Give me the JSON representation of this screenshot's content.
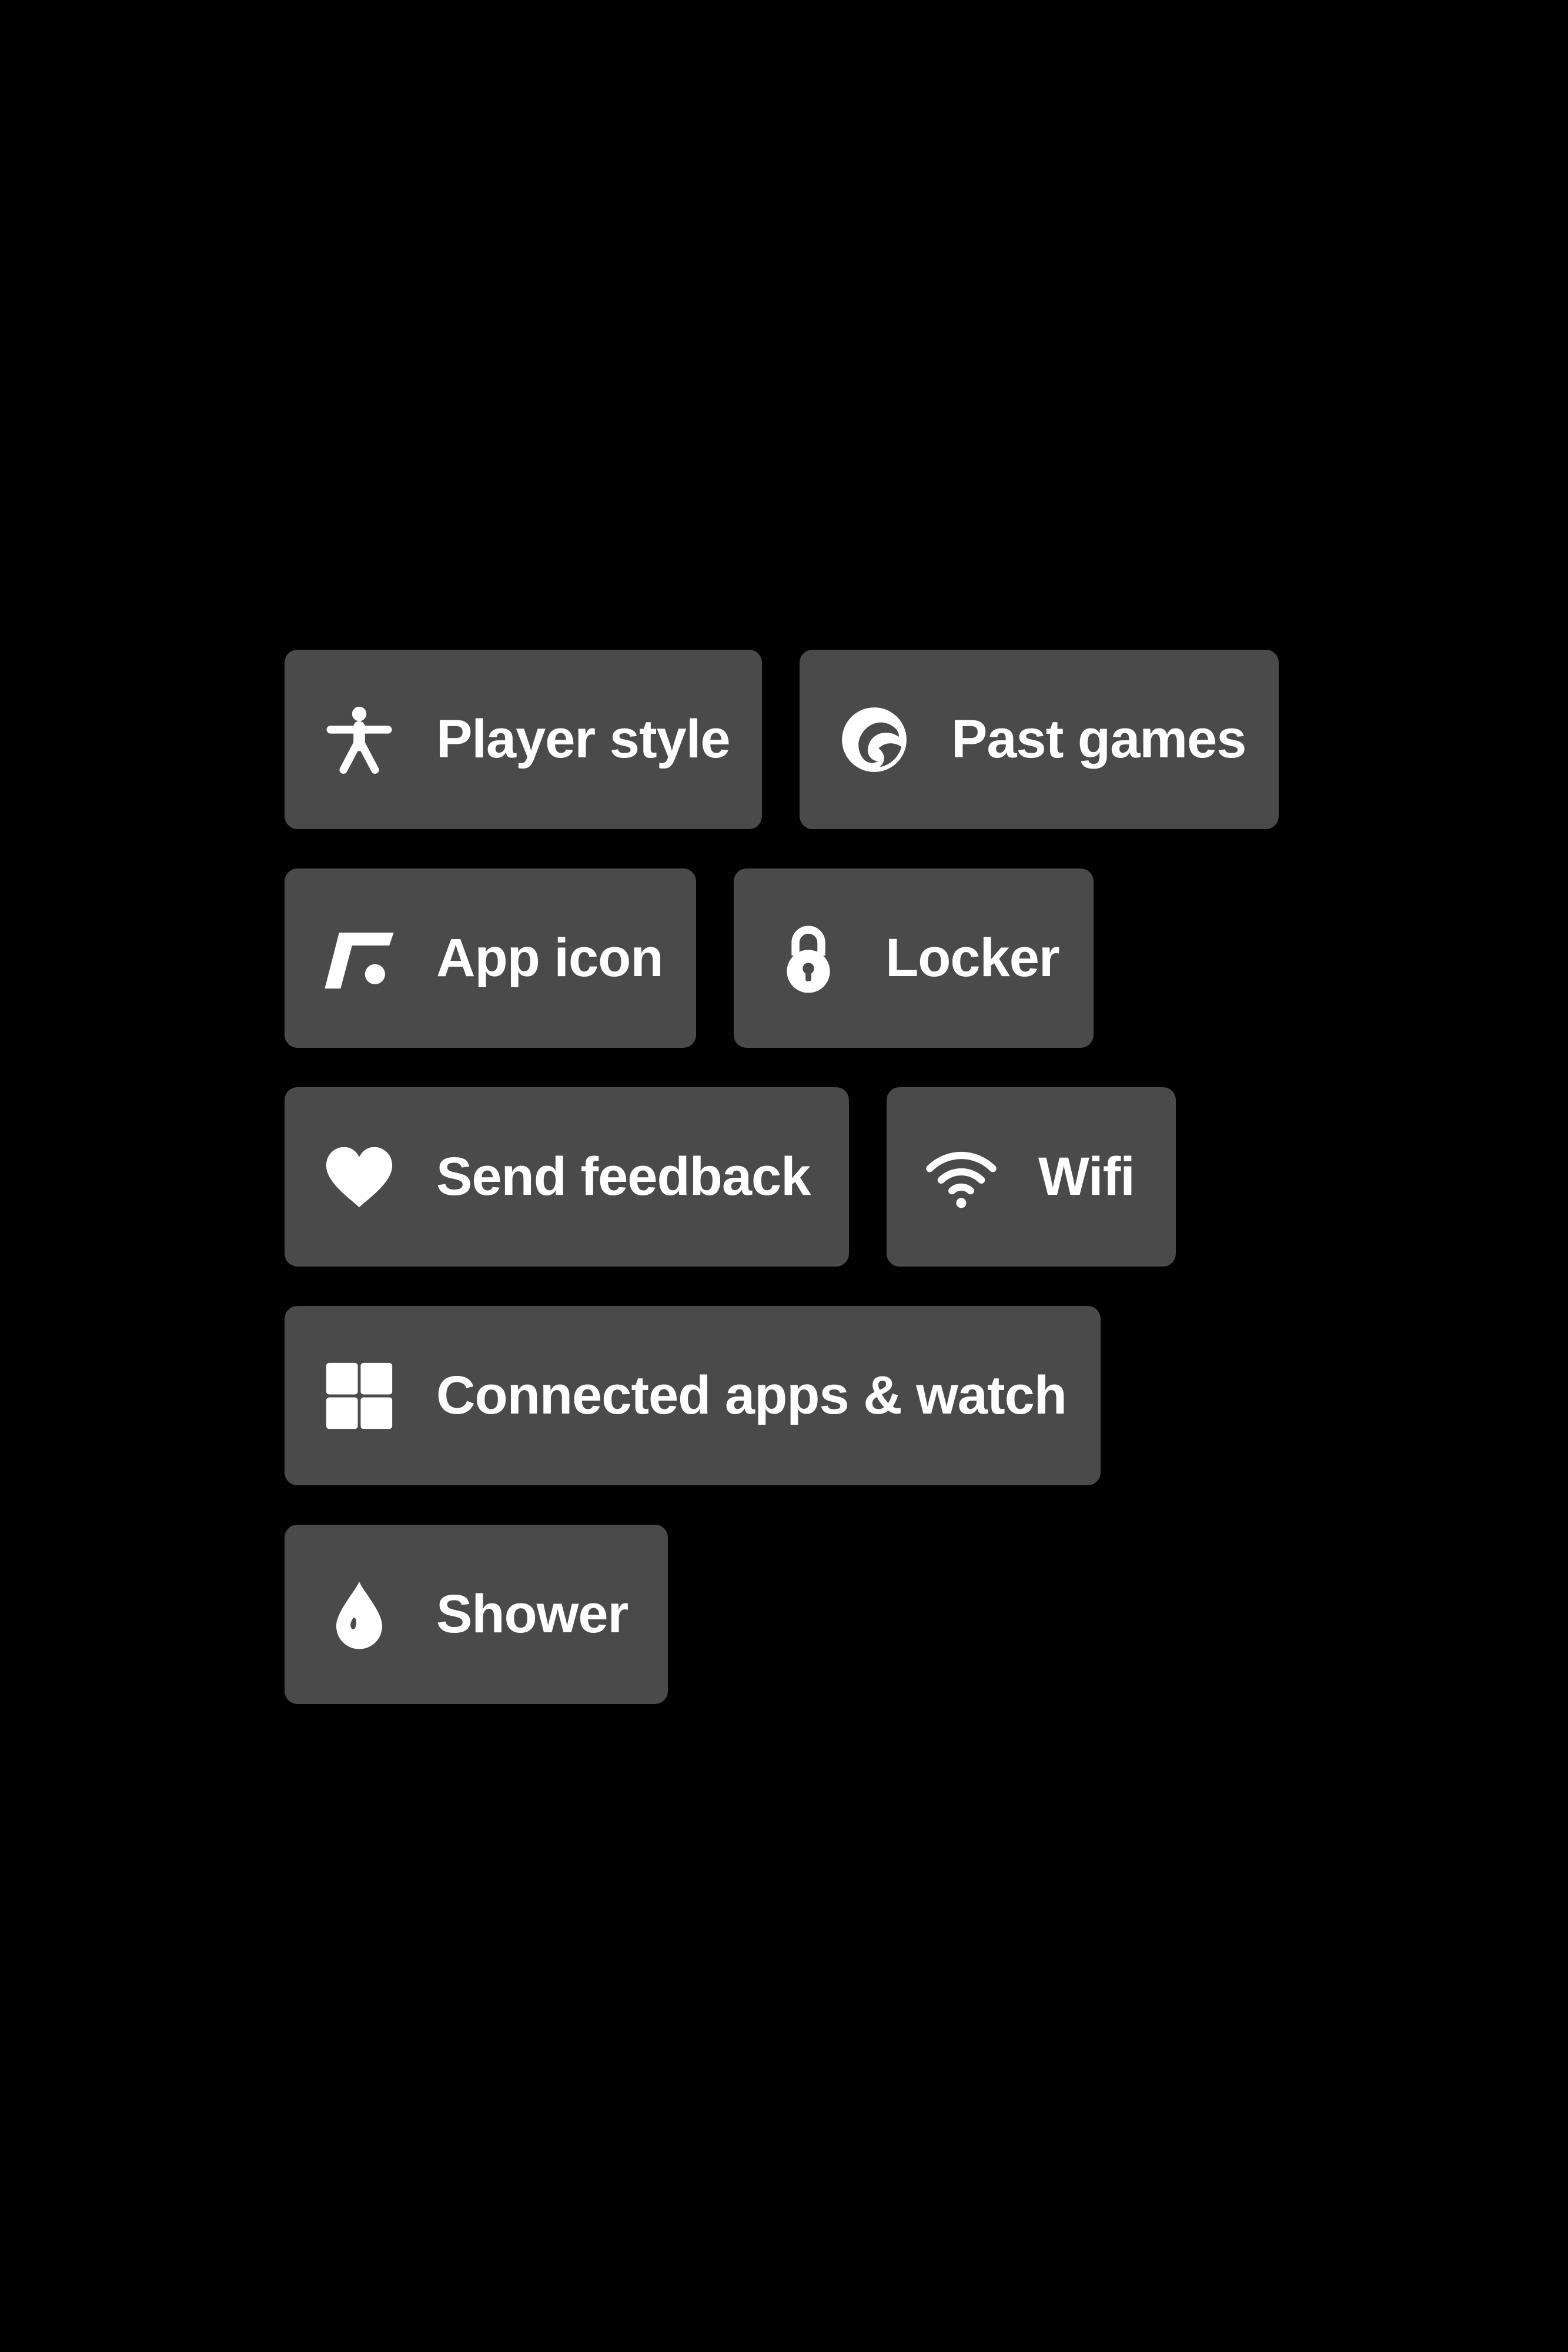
{
  "colors": {
    "background": "#000000",
    "chip_background": "#4a4a4a",
    "text": "#ffffff",
    "icon": "#ffffff"
  },
  "menu": {
    "items": [
      {
        "label": "Player style",
        "icon": "person-figure-icon"
      },
      {
        "label": "Past games",
        "icon": "swirl-logo-icon"
      },
      {
        "label": "App icon",
        "icon": "app-logo-icon"
      },
      {
        "label": "Locker",
        "icon": "lock-icon"
      },
      {
        "label": "Send feedback",
        "icon": "heart-icon"
      },
      {
        "label": "Wifi",
        "icon": "wifi-icon"
      },
      {
        "label": "Connected apps & watch",
        "icon": "grid-squares-icon"
      },
      {
        "label": "Shower",
        "icon": "water-drop-icon"
      }
    ]
  }
}
